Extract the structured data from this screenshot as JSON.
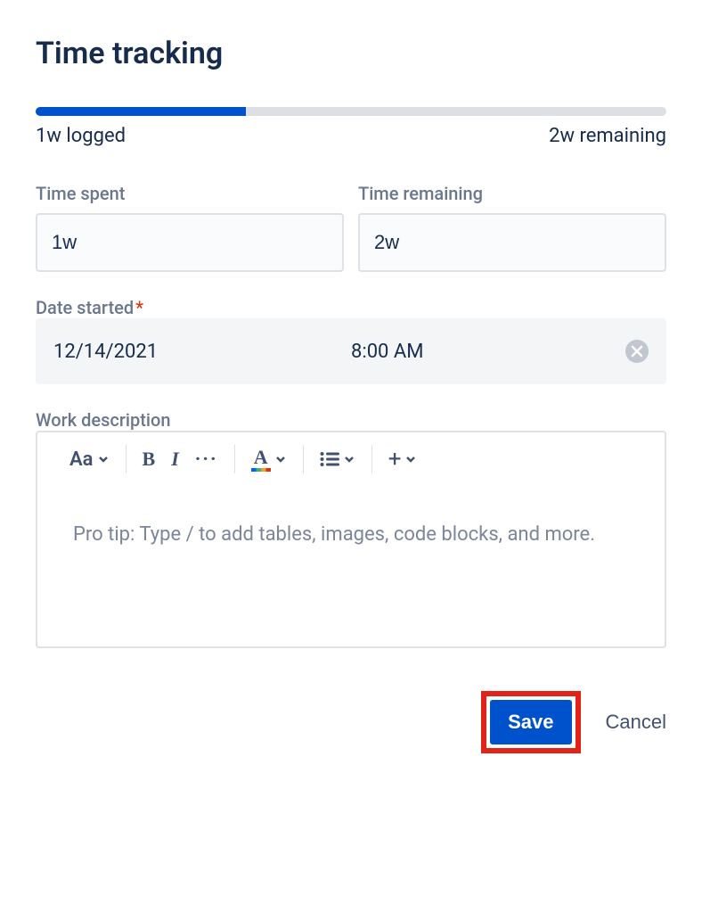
{
  "title": "Time tracking",
  "progress": {
    "percent": 33.3,
    "logged_label": "1w logged",
    "remaining_label": "2w remaining"
  },
  "fields": {
    "time_spent": {
      "label": "Time spent",
      "value": "1w"
    },
    "time_remaining": {
      "label": "Time remaining",
      "value": "2w"
    },
    "date_started": {
      "label": "Date started",
      "required": "*",
      "date": "12/14/2021",
      "time": "8:00 AM"
    },
    "work_description": {
      "label": "Work description",
      "placeholder": "Pro tip: Type / to add tables, images, code blocks, and more."
    }
  },
  "toolbar": {
    "text_style": "Aa",
    "bold": "B",
    "italic": "I",
    "more": "···",
    "text_color": "A",
    "plus": "+"
  },
  "actions": {
    "save": "Save",
    "cancel": "Cancel"
  },
  "colors": {
    "primary": "#0052CC",
    "highlight": "#E2231A"
  }
}
